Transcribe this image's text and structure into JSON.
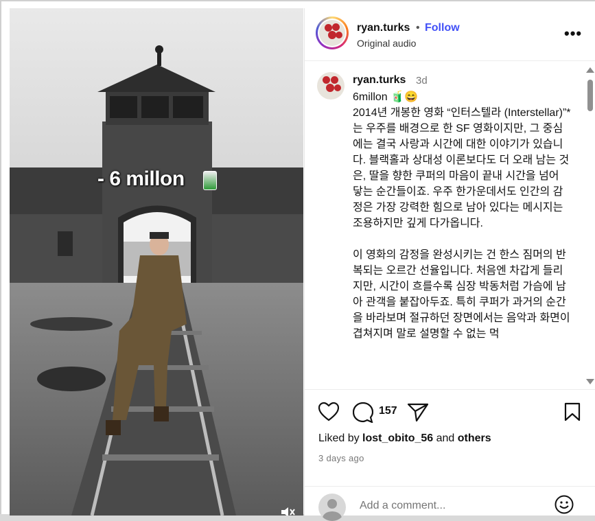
{
  "media": {
    "overlay_text": "- 6 millon"
  },
  "header": {
    "username": "ryan.turks",
    "separator": "•",
    "follow_label": "Follow",
    "audio_label": "Original audio",
    "more_label": "•••"
  },
  "comment": {
    "username": "ryan.turks",
    "time": "3d",
    "body": "6millon 🧃😄\n2014년 개봉한 영화 “인터스텔라 (Interstellar)”*는 우주를 배경으로 한 SF 영화이지만, 그 중심에는 결국 사랑과 시간에 대한 이야기가 있습니다. 블랙홀과 상대성 이론보다도 더 오래 남는 것은, 딸을 향한 쿠퍼의 마음이 끝내 시간을 넘어 닿는 순간들이죠. 우주 한가운데서도 인간의 감정은 가장 강력한 힘으로 남아 있다는 메시지는 조용하지만 깊게 다가옵니다.\n\n이 영화의 감정을 완성시키는 건 한스 짐머의 반복되는 오르간 선율입니다. 처음엔 차갑게 들리지만, 시간이 흐를수록 심장 박동처럼 가슴에 남아 관객을 붙잡아두죠. 특히 쿠퍼가 과거의 순간을 바라보며 절규하던 장면에서는 음악과 화면이 겹쳐지며 말로 설명할 수 없는 먹"
  },
  "actions": {
    "comment_count": "157",
    "liked_by_prefix": "Liked by ",
    "liked_by_user": "lost_obito_56",
    "liked_by_and": " and ",
    "liked_by_others": "others",
    "time_ago": "3 days ago",
    "add_comment_placeholder": "Add a comment..."
  },
  "colors": {
    "follow": "#4150f7",
    "text": "#111111",
    "muted": "#777777"
  }
}
